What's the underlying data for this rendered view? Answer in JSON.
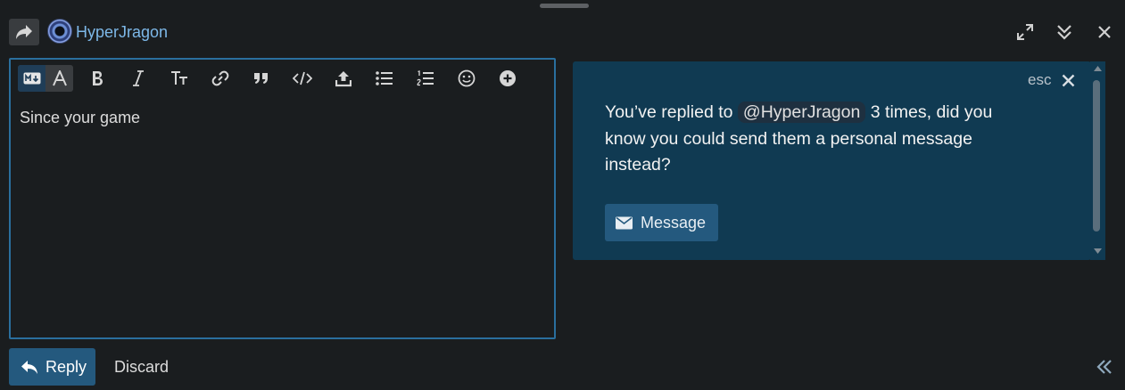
{
  "header": {
    "username": "HyperJragon",
    "icons": {
      "reply_to": "share-arrow-icon",
      "fullscreen": "expand-icon",
      "minimize": "chevrons-down-icon",
      "close": "close-icon"
    }
  },
  "editor": {
    "text": "Since your game",
    "toolbar": [
      "markdown-toggle",
      "rich-text-toggle",
      "bold",
      "italic",
      "heading",
      "link",
      "blockquote",
      "code",
      "upload",
      "bullet-list",
      "numbered-list",
      "emoji",
      "more"
    ]
  },
  "popup": {
    "esc_label": "esc",
    "message_before": "You’ve replied to",
    "mention": "@HyperJragon",
    "message_after": "3 times, did you know you could send them a personal message instead?",
    "button_label": "Message"
  },
  "footer": {
    "reply_label": "Reply",
    "discard_label": "Discard"
  },
  "colors": {
    "background": "#1a1d1f",
    "accent": "#24597e",
    "popup_bg": "#103a52",
    "editor_border": "#2a6f9e",
    "username": "#7db8e8"
  }
}
